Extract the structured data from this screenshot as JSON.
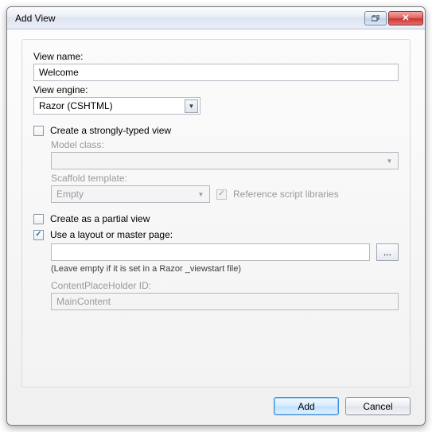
{
  "title": "Add View",
  "labels": {
    "viewName": "View name:",
    "viewEngine": "View engine:",
    "stronglyTyped": "Create a strongly-typed view",
    "modelClass": "Model class:",
    "scaffold": "Scaffold template:",
    "refScripts": "Reference script libraries",
    "partial": "Create as a partial view",
    "useLayout": "Use a layout or master page:",
    "layoutHint": "(Leave empty if it is set in a Razor _viewstart file)",
    "cphId": "ContentPlaceHolder ID:"
  },
  "values": {
    "viewName": "Welcome",
    "viewEngine": "Razor (CSHTML)",
    "modelClass": "",
    "scaffold": "Empty",
    "layoutPath": "",
    "cphId": "MainContent"
  },
  "checks": {
    "stronglyTyped": false,
    "refScripts": true,
    "partial": false,
    "useLayout": true
  },
  "buttons": {
    "browse": "...",
    "add": "Add",
    "cancel": "Cancel"
  }
}
